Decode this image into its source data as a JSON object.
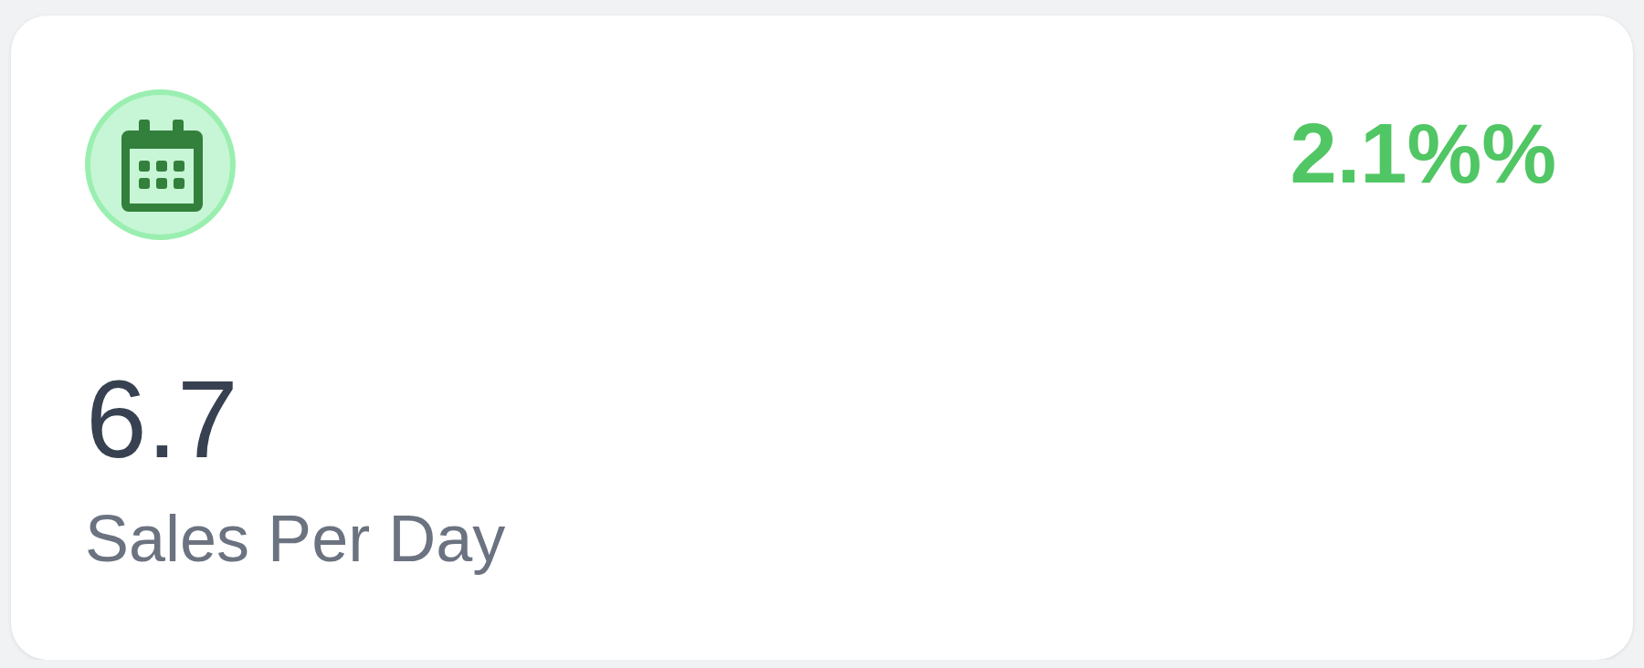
{
  "stat_card": {
    "change": "2.1%%",
    "value": "6.7",
    "label": "Sales Per Day"
  }
}
